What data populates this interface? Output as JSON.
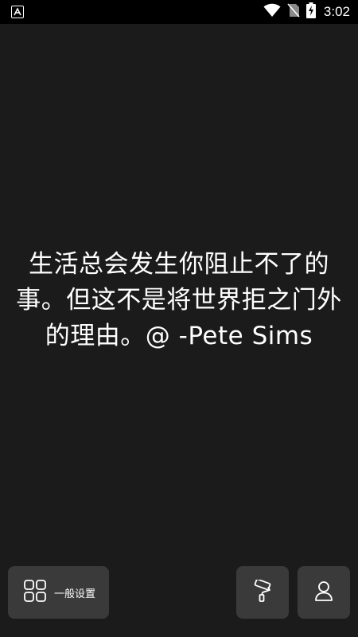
{
  "status_bar": {
    "time": "3:02",
    "icons": [
      "app-notification-icon",
      "wifi-icon",
      "no-sim-icon",
      "battery-charging-icon"
    ]
  },
  "quote": {
    "text": "生活总会发生你阻止不了的事。但这不是将世界拒之门外的理由。@ -Pete Sims"
  },
  "bottom_bar": {
    "settings_label": "一般设置",
    "settings_icon": "grid-icon",
    "theme_icon": "paint-roller-icon",
    "profile_icon": "user-icon"
  },
  "colors": {
    "background": "#1b1b1b",
    "button_bg": "#3a3a3a",
    "status_bar_bg": "#000000",
    "text": "#ffffff"
  }
}
